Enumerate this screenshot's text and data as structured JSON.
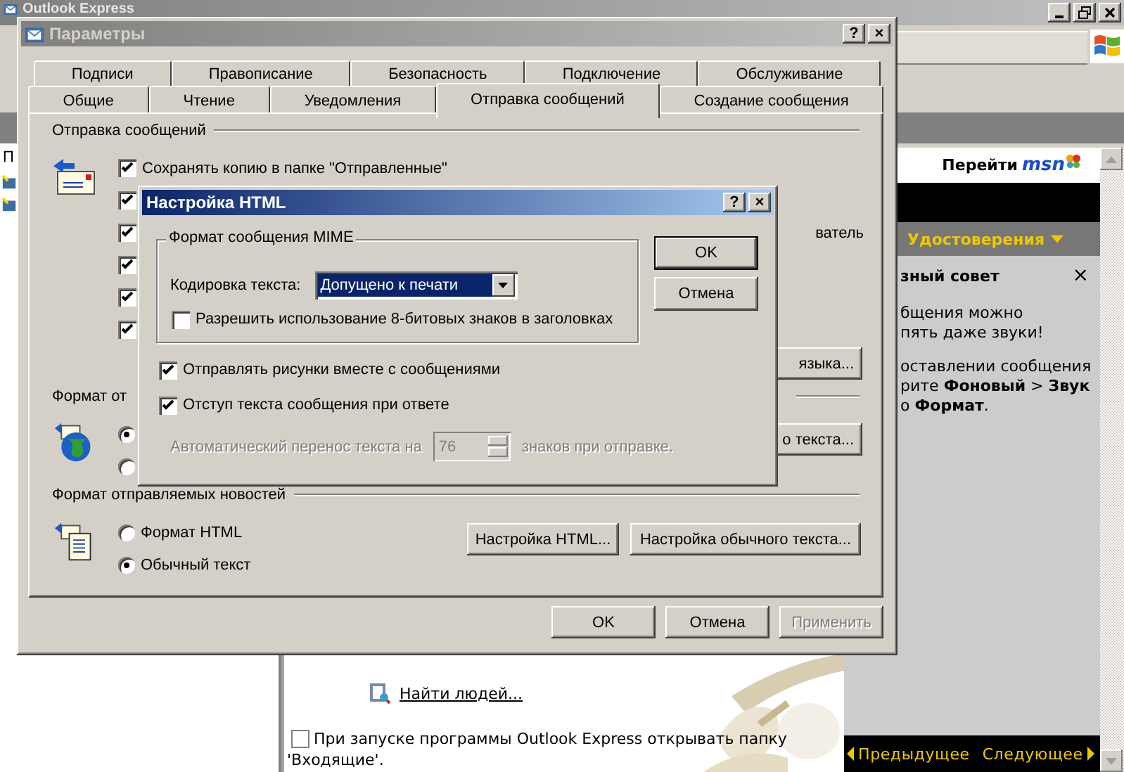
{
  "main_window": {
    "title": "Outlook Express",
    "folder_pane_text": "П",
    "msn_link": "Перейти",
    "msn_logo": "msn",
    "credentials_menu": "Удостоверения",
    "tip": {
      "heading": "зный совет",
      "close": "×",
      "paragraphs": [
        [
          "бщения можно",
          "пять даже звуки!"
        ],
        [
          "оставлении сообщения",
          "рите **Фоновый** > **Звук**",
          "о **Формат**."
        ]
      ]
    },
    "links": [
      {
        "label": "Найти людей..."
      }
    ],
    "startup_option": {
      "label_lines": [
        "При запуске программы Outlook Express открывать папку",
        "'Входящие'."
      ],
      "checked": false
    },
    "nav": {
      "prev": "Предыдущее",
      "next": "Следующее"
    }
  },
  "options_dialog": {
    "title": "Параметры",
    "title_buttons": [
      "?",
      "×"
    ],
    "tab_rows": [
      [
        {
          "label": "Подписи",
          "selected": false
        },
        {
          "label": "Правописание",
          "selected": false
        },
        {
          "label": "Безопасность",
          "selected": false
        },
        {
          "label": "Подключение",
          "selected": false
        },
        {
          "label": "Обслуживание",
          "selected": false
        }
      ],
      [
        {
          "label": "Общие",
          "selected": false
        },
        {
          "label": "Чтение",
          "selected": false
        },
        {
          "label": "Уведомления",
          "selected": false
        },
        {
          "label": "Отправка сообщений",
          "selected": true
        },
        {
          "label": "Создание сообщения",
          "selected": false
        }
      ]
    ],
    "send_group": {
      "title": "Отправка сообщений",
      "options": [
        {
          "label": "Сохранять копию в папке \"Отправленные\"",
          "checked": true
        },
        {
          "checked": true
        },
        {
          "label": "ватель",
          "cut": true,
          "checked": true
        },
        {
          "checked": true
        },
        {
          "checked": true
        },
        {
          "checked": true
        }
      ],
      "button": "языка..."
    },
    "mail_format_group": {
      "title": "Формат от",
      "options": [
        {
          "selected": true
        },
        {
          "selected": false
        }
      ],
      "button": "о текста..."
    },
    "news_format_group": {
      "title": "Формат отправляемых новостей",
      "options": [
        {
          "label": "Формат HTML",
          "selected": false
        },
        {
          "label": "Обычный текст",
          "selected": true
        }
      ],
      "buttons": [
        "Настройка HTML...",
        "Настройка обычного текста..."
      ]
    },
    "footer_buttons": [
      {
        "label": "OK",
        "disabled": false
      },
      {
        "label": "Отмена",
        "disabled": false
      },
      {
        "label": "Применить",
        "disabled": true
      }
    ]
  },
  "html_dialog": {
    "title": "Настройка HTML",
    "title_buttons": [
      "?",
      "×"
    ],
    "mime_group": {
      "title": "Формат сообщения MIME",
      "encoding_label": "Кодировка текста:",
      "encoding_value": "Допущено к печати",
      "allow_8bit": {
        "label": "Разрешить использование 8-битовых знаков в заголовках",
        "checked": false
      }
    },
    "buttons": [
      {
        "label": "OK",
        "default": true
      },
      {
        "label": "Отмена",
        "default": false
      }
    ],
    "options": [
      {
        "label": "Отправлять рисунки вместе с сообщениями",
        "checked": true
      },
      {
        "label": "Отступ текста сообщения при ответе",
        "checked": true
      }
    ],
    "wrap": {
      "label_before": "Автоматический перенос текста на",
      "value": "76",
      "label_after": "знаков при отправке.",
      "disabled": true
    }
  }
}
